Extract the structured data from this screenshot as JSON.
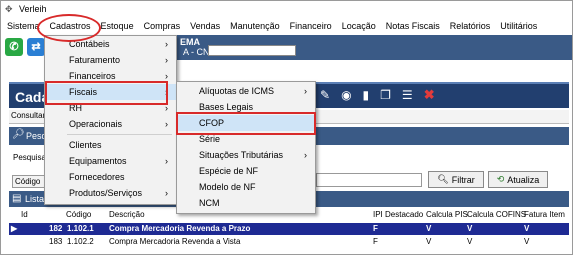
{
  "title": "Verleih",
  "menubar": [
    "Sistema",
    "Cadastros",
    "Estoque",
    "Compras",
    "Vendas",
    "Manutenção",
    "Financeiro",
    "Locação",
    "Notas Fiscais",
    "Relatórios",
    "Utilitários"
  ],
  "header": {
    "system_name": "EMA",
    "cnpj_label": "A - CNPJ :"
  },
  "window": {
    "title": "Cada",
    "tab": "Consultar",
    "section": "Pesq",
    "search_label": "Pesquisa",
    "code_label": "Código",
    "filter_button": "Filtrar",
    "refresh_button": "Atualiza",
    "list_label": "Lista"
  },
  "grid": {
    "columns": [
      "Id",
      "Código",
      "Descrição",
      "IPI Destacado",
      "Calcula PIS",
      "Calcula COFINS",
      "Fatura Item"
    ],
    "rows": [
      {
        "id": "182",
        "codigo": "1.102.1",
        "descricao": "Compra Mercadoria Revenda a Prazo",
        "ipi": "F",
        "pis": "V",
        "cofins": "V",
        "fatura": "V"
      },
      {
        "id": "183",
        "codigo": "1.102.2",
        "descricao": "Compra Mercadoria Revenda a Vista",
        "ipi": "F",
        "pis": "V",
        "cofins": "V",
        "fatura": "V"
      }
    ]
  },
  "cadastros_menu": [
    "Contábeis",
    "Faturamento",
    "Financeiros",
    "Fiscais",
    "RH",
    "Operacionais",
    "Clientes",
    "Equipamentos",
    "Fornecedores",
    "Produtos/Serviços"
  ],
  "fiscais_menu": [
    "Alíquotas de ICMS",
    "Bases Legais",
    "CFOP",
    "Série",
    "Situações Tributárias",
    "Espécie de NF",
    "Modelo de NF",
    "NCM"
  ],
  "arrow": "›",
  "colors": {
    "highlight_red": "#d82a2a",
    "nav_blue": "#223f6f",
    "selected_row": "#1e2a93"
  }
}
